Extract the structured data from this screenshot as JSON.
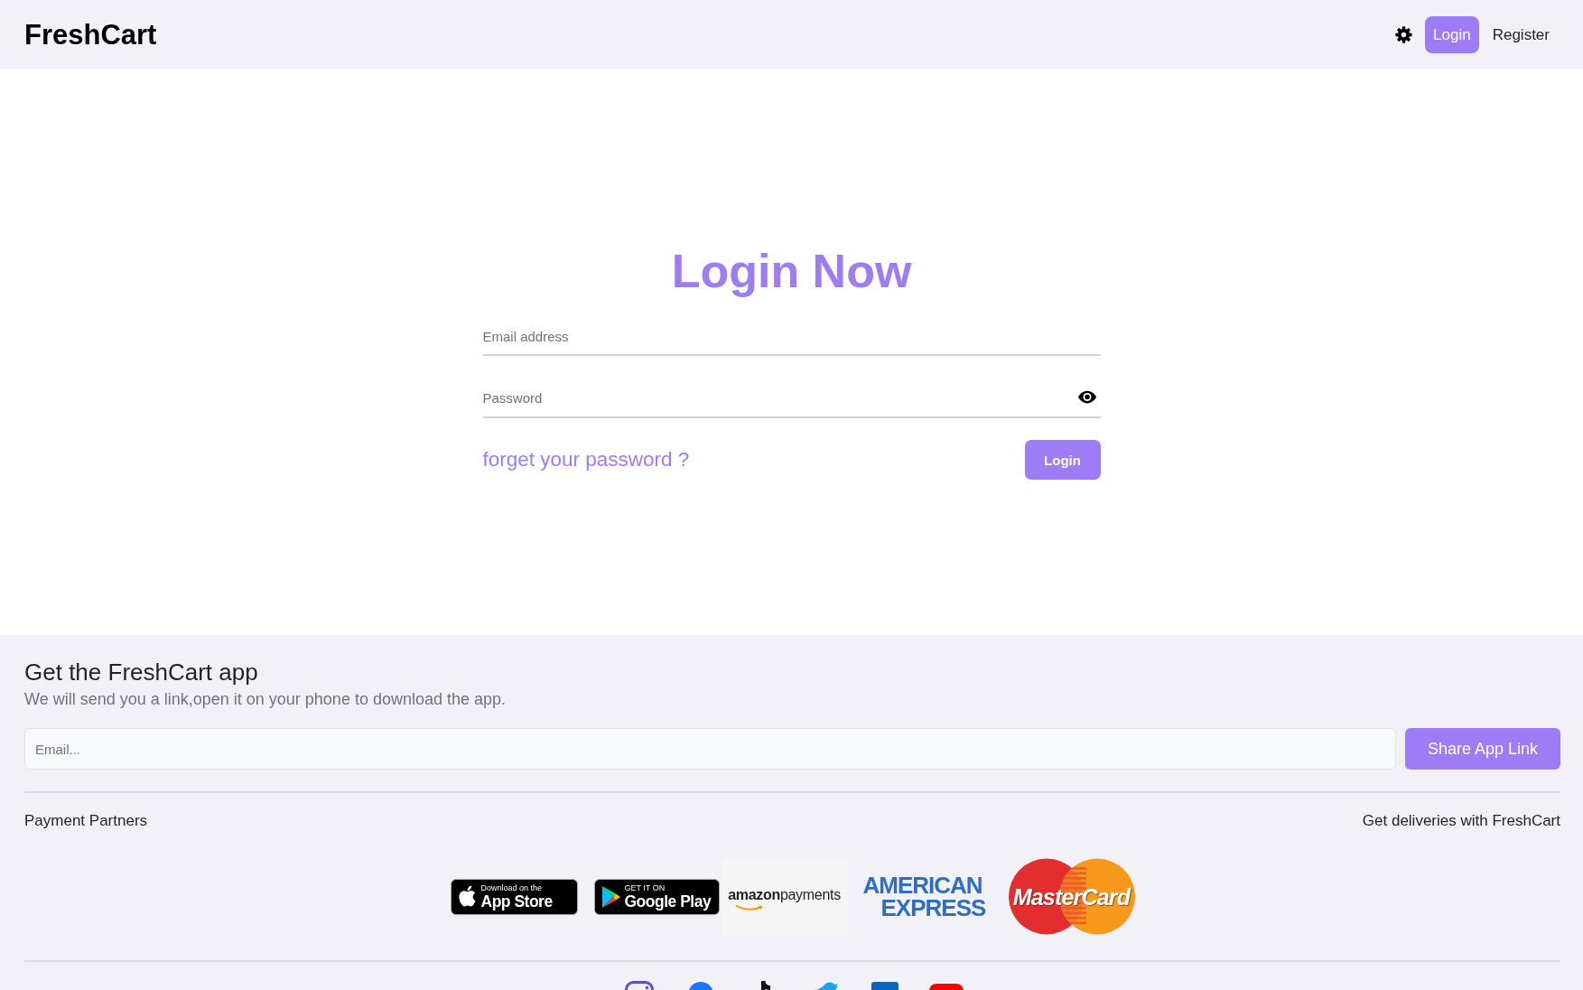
{
  "header": {
    "brand": "FreshCart",
    "nav": [
      {
        "label": "Login",
        "selected": true
      },
      {
        "label": "Register",
        "selected": false
      }
    ]
  },
  "login": {
    "title": "Login Now",
    "fields": [
      {
        "kind": "email",
        "placeholder": "Email address"
      },
      {
        "kind": "password",
        "placeholder": "Password"
      }
    ],
    "forgot_link": "forget your password ?",
    "submit": "Login"
  },
  "footer": {
    "title": "Get the FreshCart app",
    "subtitle": "We will send you a link,open it on your phone to download the app.",
    "email_placeholder": "Email...",
    "share_button": "Share App Link",
    "partners_label": "Payment Partners",
    "deliveries_label": "Get deliveries with FreshCart",
    "logos": [
      {
        "kind": "app_store",
        "caption": "Download on the",
        "label": "App Store"
      },
      {
        "kind": "google_play",
        "caption": "GET IT ON",
        "label": "Google Play"
      },
      {
        "kind": "amazon_payments",
        "text": "**amazon**payments"
      },
      {
        "kind": "amex",
        "lines": [
          "AMERICAN",
          "EXPRESS"
        ]
      },
      {
        "kind": "mastercard",
        "text": "MasterCard"
      }
    ],
    "social_links": [
      {
        "kind": "instagram"
      },
      {
        "kind": "facebook"
      },
      {
        "kind": "tiktok"
      },
      {
        "kind": "twitter"
      },
      {
        "kind": "linkedin"
      },
      {
        "kind": "youtube"
      }
    ]
  }
}
